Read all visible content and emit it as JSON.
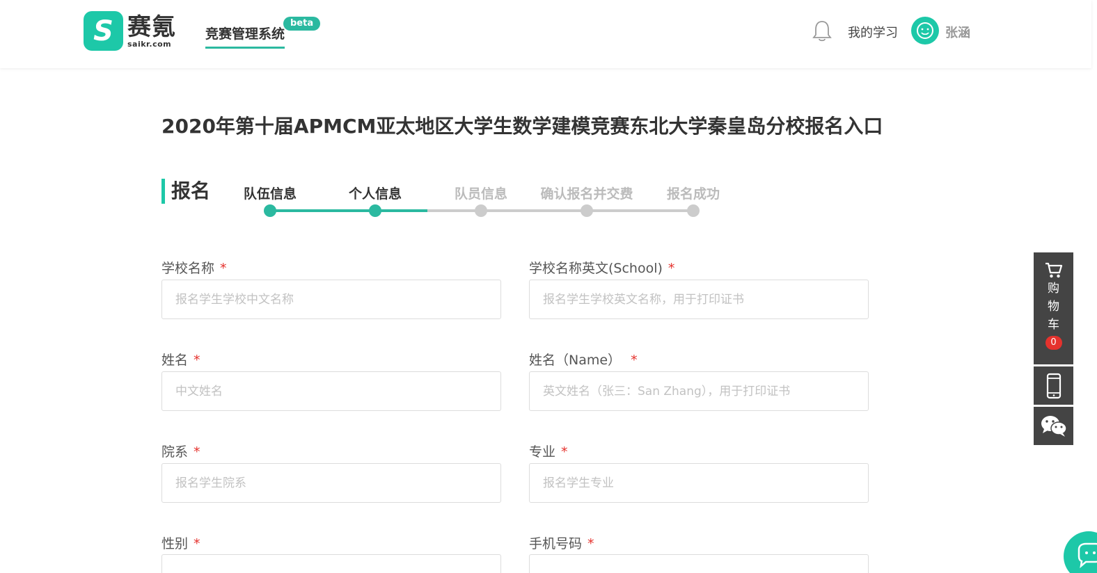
{
  "header": {
    "logo_cn": "赛氪",
    "logo_en": "saikr.com",
    "system_title": "竞赛管理系统",
    "beta_label": "beta",
    "my_study": "我的学习",
    "username": "张涵"
  },
  "page": {
    "title": "2020年第十届APMCM亚太地区大学生数学建模竞赛东北大学秦皇岛分校报名入口",
    "section_title": "报名"
  },
  "steps": [
    {
      "label": "队伍信息",
      "state": "done"
    },
    {
      "label": "个人信息",
      "state": "current"
    },
    {
      "label": "队员信息",
      "state": "todo"
    },
    {
      "label": "确认报名并交费",
      "state": "todo"
    },
    {
      "label": "报名成功",
      "state": "todo"
    }
  ],
  "form": {
    "school_name": {
      "label": "学校名称",
      "placeholder": "报名学生学校中文名称",
      "required": "*"
    },
    "school_name_en": {
      "label": "学校名称英文(School)",
      "placeholder": "报名学生学校英文名称，用于打印证书",
      "required": "*"
    },
    "name": {
      "label": "姓名",
      "placeholder": "中文姓名",
      "required": "*"
    },
    "name_en": {
      "label": "姓名（Name）",
      "placeholder": "英文姓名（张三：San Zhang），用于打印证书",
      "required": "*"
    },
    "department": {
      "label": "院系",
      "placeholder": "报名学生院系",
      "required": "*"
    },
    "major": {
      "label": "专业",
      "placeholder": "报名学生专业",
      "required": "*"
    },
    "gender": {
      "label": "性别",
      "required": "*"
    },
    "phone": {
      "label": "手机号码",
      "required": "*"
    }
  },
  "sidebar": {
    "cart_chars": [
      "购",
      "物",
      "车"
    ],
    "cart_count": "0"
  },
  "colors": {
    "accent": "#1dc8a8",
    "step_active": "#2bb9a0",
    "step_inactive": "#cccccc",
    "required": "#e5322d",
    "side_bg": "#444444"
  },
  "icons": [
    "bell-icon",
    "avatar-face-icon",
    "cart-icon",
    "mobile-icon",
    "wechat-icon",
    "chat-icon"
  ]
}
